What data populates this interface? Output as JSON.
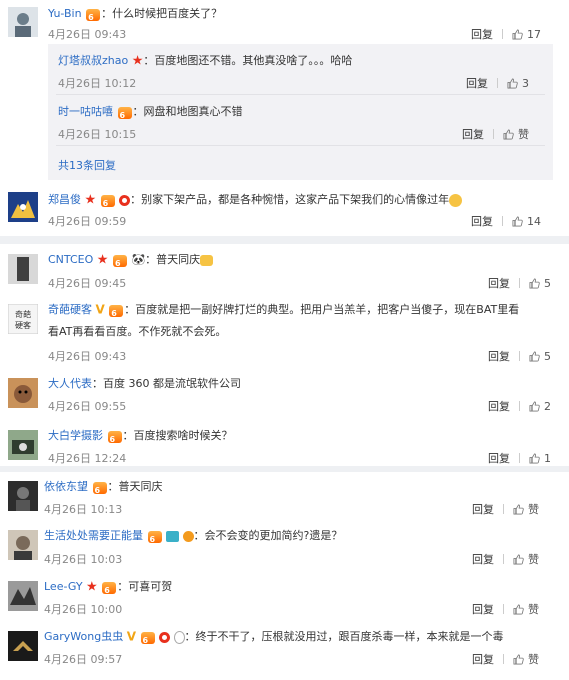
{
  "block1": {
    "main": {
      "user": "Yu-Bin",
      "text": "什么时候把百度关了？",
      "time": "4月26日 09:43",
      "reply": "回复",
      "likes": "17"
    },
    "nested": [
      {
        "user": "灯塔叔叔zhao",
        "text": "百度地图还不错。其他真没啥了。。。哈哈",
        "time": "4月26日 10:12",
        "reply": "回复",
        "likes": "3"
      },
      {
        "user": "时一咕咕嘻",
        "text": "网盘和地图真心不错",
        "time": "4月26日 10:15",
        "reply": "回复",
        "likes": "赞"
      }
    ],
    "more": "共13条回复",
    "second": {
      "user": "郑昌俊",
      "text": "别家下架产品，都是各种惋惜，这家产品下架我们的心情像过年",
      "time": "4月26日 09:59",
      "reply": "回复",
      "likes": "14"
    }
  },
  "block2": {
    "items": [
      {
        "user": "CNTCEO",
        "text": "普天同庆",
        "time": "4月26日 09:45",
        "reply": "回复",
        "likes": "5"
      },
      {
        "user": "奇葩硬客",
        "text1": "百度就是把一副好牌打烂的典型。把用户当羔羊，把客户当傻子，现在BAT里看",
        "text2": "看AT再看看百度。不作死就不会死。",
        "time": "4月26日 09:43",
        "reply": "回复",
        "likes": "5"
      },
      {
        "user": "大人代表",
        "text": "百度 360 都是流氓软件公司",
        "time": "4月26日 09:55",
        "reply": "回复",
        "likes": "2"
      },
      {
        "user": "大白学摄影",
        "text": "百度搜索啥时候关？",
        "time": "4月26日 12:24",
        "reply": "回复",
        "likes": "1"
      }
    ]
  },
  "block3": {
    "items": [
      {
        "user": "依依东望",
        "text": "普天同庆",
        "time": "4月26日 10:13",
        "reply": "回复",
        "likes": "赞"
      },
      {
        "user": "生活处处需要正能量",
        "text": "会不会变的更加简约?遗是？",
        "time": "4月26日 10:03",
        "reply": "回复",
        "likes": "赞"
      },
      {
        "user": "Lee-GY",
        "text": "可喜可贺",
        "time": "4月26日 10:00",
        "reply": "回复",
        "likes": "赞"
      },
      {
        "user": "GaryWong虫虫",
        "text": "终于不干了，压根就没用过，跟百度杀毒一样，本来就是一个毒",
        "time": "4月26日 09:57",
        "reply": "回复",
        "likes": "赞"
      }
    ]
  },
  "colors": {
    "username": "#2c6cc4",
    "time": "#888888",
    "separator": "#eef0f3",
    "nested_bg": "#f2f2f5"
  },
  "icons": [
    "avatar",
    "vip-badge",
    "star-icon",
    "level-badge",
    "thumbs-up-icon",
    "emoji-icon"
  ],
  "avatar_colors": [
    "#6b7d8a",
    "#1d3f88",
    "#3f3f3f",
    "#c9c9b8",
    "#8a5a3a",
    "#4b6a4b",
    "#2d2d2d",
    "#7a6a5a",
    "#5d5d5d",
    "#3a2a1a"
  ]
}
